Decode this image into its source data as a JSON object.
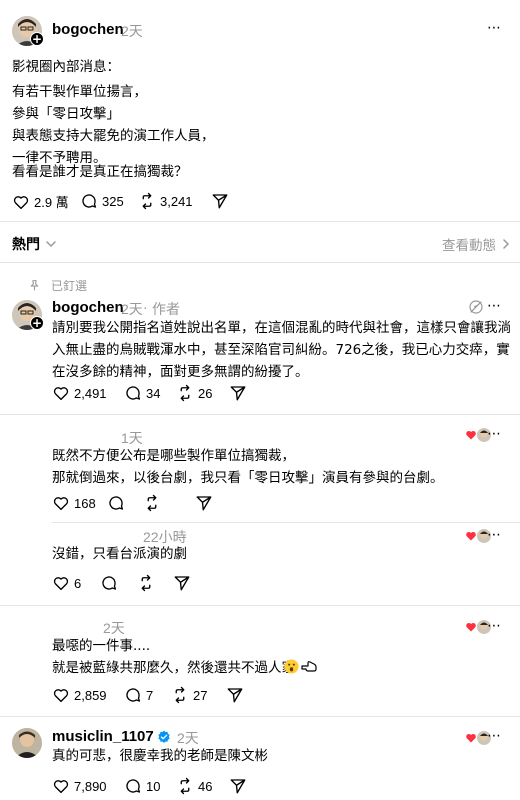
{
  "main_post": {
    "username": "bogochen",
    "time": "2天",
    "lines": [
      "影視圈內部消息：",
      "有若干製作單位揚言，\n參與「零日攻擊」\n與表態支持大罷免的演工作人員，\n一律不予聘用。",
      "看看是誰才是真正在搞獨裁？"
    ],
    "likes": "2.9 萬",
    "comments": "325",
    "reposts": "3,241"
  },
  "sort_bar": {
    "label": "熱門",
    "view_activity": "查看動態"
  },
  "pinned_label": "已釘選",
  "pinned_reply": {
    "username": "bogochen",
    "time": "2天",
    "author_tag": "作者",
    "text": "請別要我公開指名道姓說出名單，在這個混亂的時代與社會，這樣只會讓我淌入無止盡的烏賊戰渾水中，甚至深陷官司糾紛。726之後，我已心力交瘁，實在沒多餘的精神，面對更多無謂的紛擾了。",
    "likes": "2,491",
    "comments": "34",
    "reposts": "26"
  },
  "reply_1": {
    "time": "1天",
    "text": "既然不方便公布是哪些製作單位搞獨裁，\n那就倒過來，以後台劇，我只看「零日攻擊」演員有參與的台劇。",
    "likes": "168"
  },
  "reply_2": {
    "time": "22小時",
    "text": "沒錯，只看台派演的劇",
    "likes": "6"
  },
  "reply_3": {
    "time": "2天",
    "text": "最噁的一件事....\n就是被藍綠共那麼久，然後還共不過人家",
    "likes": "2,859",
    "comments": "7",
    "reposts": "27"
  },
  "reply_4": {
    "username": "musiclin_1107",
    "time": "2天",
    "text": "真的可悲，很慶幸我的老師是陳文彬",
    "likes": "7,890",
    "comments": "10",
    "reposts": "46"
  },
  "more_icon": "⋯",
  "colors": {
    "accent_heart": "#ff3040",
    "verified": "#0095f6",
    "secondary": "#999999",
    "divider": "#e5e5e5"
  }
}
